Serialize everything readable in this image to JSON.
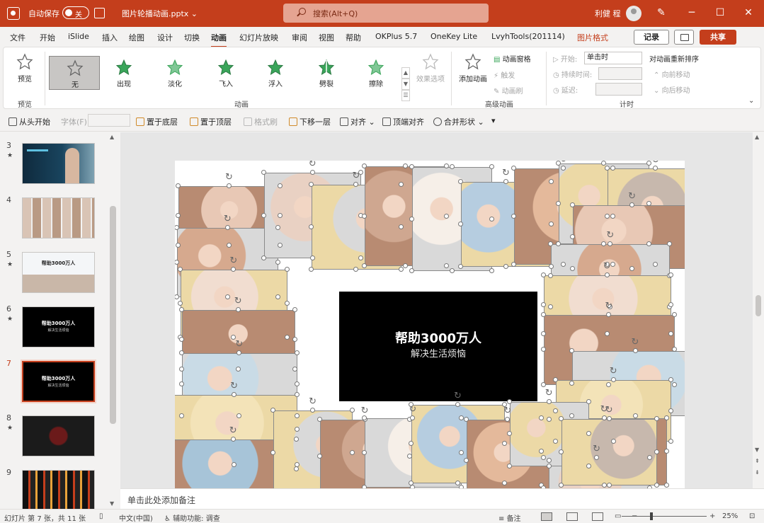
{
  "titlebar": {
    "autosave_label": "自动保存",
    "autosave_state": "关",
    "document_title": "图片轮播动画.pptx ⌄",
    "search_placeholder": "搜索(Alt+Q)",
    "user_name": "利健 程",
    "accent_color": "#c43e1c"
  },
  "menu": {
    "tabs": [
      "文件",
      "开始",
      "iSlide",
      "插入",
      "绘图",
      "设计",
      "切换",
      "动画",
      "幻灯片放映",
      "审阅",
      "视图",
      "帮助",
      "OKPlus 5.7",
      "OneKey Lite",
      "LvyhTools(201114)",
      "图片格式"
    ],
    "active_tab": "动画",
    "record_label": "记录",
    "share_label": "共享"
  },
  "ribbon": {
    "preview_label": "预览",
    "preview_group": "预览",
    "effects": [
      "无",
      "出现",
      "淡化",
      "飞入",
      "浮入",
      "劈裂",
      "擦除"
    ],
    "effect_options_label": "效果选项",
    "animation_group": "动画",
    "add_animation_label": "添加动画",
    "animation_pane_label": "动画窗格",
    "trigger_label": "触发",
    "animation_painter_label": "动画刷",
    "advanced_group": "高级动画",
    "start_label": "开始:",
    "start_value": "单击时",
    "duration_label": "持续时间:",
    "delay_label": "延迟:",
    "timing_group": "计时",
    "reorder_label": "对动画重新排序",
    "move_earlier": "向前移动",
    "move_later": "向后移动"
  },
  "qat": {
    "from_beginning": "从头开始",
    "font_label": "字体(F):",
    "send_to_back": "置于底层",
    "bring_to_front": "置于顶层",
    "format_painter": "格式刷",
    "send_backward": "下移一层",
    "align": "对齐",
    "align_top": "顶端对齐",
    "merge_shapes": "合并形状"
  },
  "thumbnails": [
    {
      "num": "3",
      "star": "★",
      "title": "",
      "sub": ""
    },
    {
      "num": "4",
      "star": "",
      "title": "",
      "sub": ""
    },
    {
      "num": "5",
      "star": "★",
      "title": "帮助3000万人",
      "sub": ""
    },
    {
      "num": "6",
      "star": "★",
      "title": "帮助3000万人",
      "sub": "解决生活烦恼"
    },
    {
      "num": "7",
      "star": "",
      "title": "帮助3000万人",
      "sub": "解决生活烦恼"
    },
    {
      "num": "8",
      "star": "★",
      "title": "",
      "sub": ""
    },
    {
      "num": "9",
      "star": "",
      "title": "",
      "sub": ""
    }
  ],
  "slide": {
    "headline": "帮助3000万人",
    "subline": "解决生活烦恼"
  },
  "notes_placeholder": "单击此处添加备注",
  "status": {
    "slide_info": "幻灯片 第 7 张，共 11 张",
    "language": "中文(中国)",
    "accessibility": "辅助功能: 调查",
    "notes_label": "备注",
    "zoom": "25%"
  }
}
